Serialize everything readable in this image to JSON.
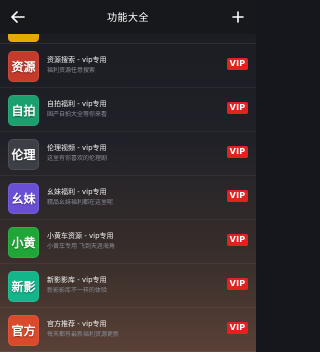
{
  "header": {
    "title": "功能大全",
    "back_icon": "arrow-left-icon",
    "add_icon": "plus-icon"
  },
  "colors": {
    "vip_badge": "#e32121",
    "header_bg": "#17181c"
  },
  "apps": [
    {
      "icon_text": "资源",
      "name": "资源搜索 - vip专用",
      "desc": "福利资源任意搜索",
      "badge": "VIP",
      "icon_bg": "#c53a2a"
    },
    {
      "icon_text": "自拍",
      "name": "自拍福利 - vip专用",
      "desc": "国产自拍大全等你来看",
      "badge": "VIP",
      "icon_bg": "#1a9f6e"
    },
    {
      "icon_text": "伦理",
      "name": "伦理视频 - vip专用",
      "desc": "这里有你喜欢的伦理剧",
      "badge": "VIP",
      "icon_bg": "#3d3f46"
    },
    {
      "icon_text": "幺妹",
      "name": "幺妹福利 - vip专用",
      "desc": "精品幺妹福利都在这里呢",
      "badge": "VIP",
      "icon_bg": "#6a4fd6"
    },
    {
      "icon_text": "小黄",
      "name": "小黄车资源 - vip专用",
      "desc": "小黄车专用 飞到天涯海角",
      "badge": "VIP",
      "icon_bg": "#1fa637"
    },
    {
      "icon_text": "新影",
      "name": "新影影库 - vip专用",
      "desc": "新影影库不一样的体验",
      "badge": "VIP",
      "icon_bg": "#13b58a"
    },
    {
      "icon_text": "官方",
      "name": "官方推荐 - vip专用",
      "desc": "每天都有最新福利资源更新",
      "badge": "VIP",
      "icon_bg": "#d9492a"
    }
  ]
}
